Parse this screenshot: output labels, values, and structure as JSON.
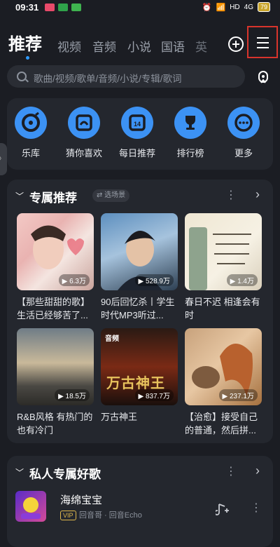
{
  "status": {
    "time": "09:31",
    "battery": "79",
    "network": "HD",
    "signal": "4G"
  },
  "nav": {
    "active_tab": "推荐",
    "tabs": [
      "视频",
      "音频",
      "小说",
      "国语",
      "英"
    ]
  },
  "search": {
    "placeholder": "歌曲/视频/歌单/音频/小说/专辑/歌词"
  },
  "quick_links": [
    {
      "label": "乐库",
      "icon": "music-library-icon"
    },
    {
      "label": "猜你喜欢",
      "icon": "guess-like-icon"
    },
    {
      "label": "每日推荐",
      "icon": "daily-calendar-icon",
      "badge": "14"
    },
    {
      "label": "排行榜",
      "icon": "trophy-icon"
    },
    {
      "label": "更多",
      "icon": "more-icon"
    }
  ],
  "exclusive": {
    "title": "专属推荐",
    "scene_button": "选场景",
    "items": [
      {
        "plays": "6.3万",
        "title": "【那些甜甜的歌】生活已经够苦了..."
      },
      {
        "plays": "528.9万",
        "title": "90后回忆杀丨学生时代MP3听过..."
      },
      {
        "plays": "1.4万",
        "title": "春日不迟 相逢会有时"
      },
      {
        "plays": "18.5万",
        "title": "R&B风格 有热门的也有冷门"
      },
      {
        "plays": "837.7万",
        "title": "万古神王",
        "tag": "音频",
        "poster": "万古神王"
      },
      {
        "plays": "237.1万",
        "title": "【治愈】接受自己的普通，然后拼..."
      }
    ]
  },
  "private": {
    "title": "私人专属好歌",
    "song": {
      "title": "海绵宝宝",
      "vip": "VIP",
      "artist": "回音哥 · 回音Echo"
    }
  },
  "colors": {
    "accent": "#3c92f4",
    "background": "#1b1d23",
    "card": "#24272e",
    "highlight_box": "#d8342c"
  }
}
